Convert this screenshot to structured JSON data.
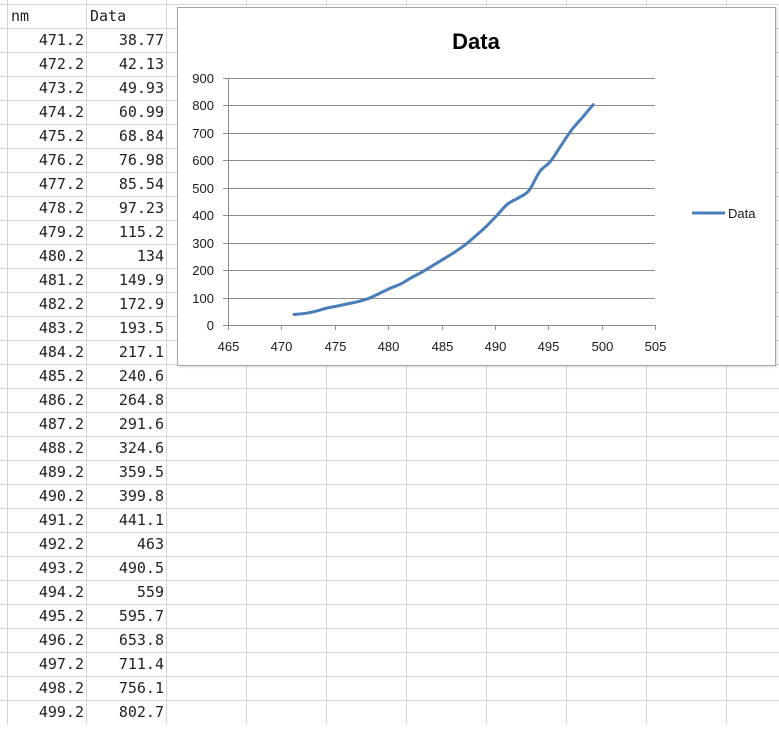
{
  "sheet": {
    "headers": {
      "col_a": "nm",
      "col_b": "Data"
    },
    "rows": [
      [
        "471.2",
        "38.77"
      ],
      [
        "472.2",
        "42.13"
      ],
      [
        "473.2",
        "49.93"
      ],
      [
        "474.2",
        "60.99"
      ],
      [
        "475.2",
        "68.84"
      ],
      [
        "476.2",
        "76.98"
      ],
      [
        "477.2",
        "85.54"
      ],
      [
        "478.2",
        "97.23"
      ],
      [
        "479.2",
        "115.2"
      ],
      [
        "480.2",
        "134"
      ],
      [
        "481.2",
        "149.9"
      ],
      [
        "482.2",
        "172.9"
      ],
      [
        "483.2",
        "193.5"
      ],
      [
        "484.2",
        "217.1"
      ],
      [
        "485.2",
        "240.6"
      ],
      [
        "486.2",
        "264.8"
      ],
      [
        "487.2",
        "291.6"
      ],
      [
        "488.2",
        "324.6"
      ],
      [
        "489.2",
        "359.5"
      ],
      [
        "490.2",
        "399.8"
      ],
      [
        "491.2",
        "441.1"
      ],
      [
        "492.2",
        "463"
      ],
      [
        "493.2",
        "490.5"
      ],
      [
        "494.2",
        "559"
      ],
      [
        "495.2",
        "595.7"
      ],
      [
        "496.2",
        "653.8"
      ],
      [
        "497.2",
        "711.4"
      ],
      [
        "498.2",
        "756.1"
      ],
      [
        "499.2",
        "802.7"
      ]
    ]
  },
  "colors": {
    "gridline": "#d4d4d4",
    "series": "#4a7ebb",
    "chart_border": "#a6a6a6"
  },
  "chart_data": {
    "type": "scatter",
    "title": "Data",
    "xlabel": "",
    "ylabel": "",
    "xlim": [
      465,
      505
    ],
    "ylim": [
      0,
      900
    ],
    "x_ticks": [
      465,
      470,
      475,
      480,
      485,
      490,
      495,
      500,
      505
    ],
    "y_ticks": [
      0,
      100,
      200,
      300,
      400,
      500,
      600,
      700,
      800,
      900
    ],
    "grid": true,
    "legend": "right",
    "series": [
      {
        "name": "Data",
        "style": "smooth-line",
        "x": [
          471.2,
          472.2,
          473.2,
          474.2,
          475.2,
          476.2,
          477.2,
          478.2,
          479.2,
          480.2,
          481.2,
          482.2,
          483.2,
          484.2,
          485.2,
          486.2,
          487.2,
          488.2,
          489.2,
          490.2,
          491.2,
          492.2,
          493.2,
          494.2,
          495.2,
          496.2,
          497.2,
          498.2,
          499.2
        ],
        "y": [
          38.77,
          42.13,
          49.93,
          60.99,
          68.84,
          76.98,
          85.54,
          97.23,
          115.2,
          134,
          149.9,
          172.9,
          193.5,
          217.1,
          240.6,
          264.8,
          291.6,
          324.6,
          359.5,
          399.8,
          441.1,
          463,
          490.5,
          559,
          595.7,
          653.8,
          711.4,
          756.1,
          802.7
        ]
      }
    ]
  }
}
